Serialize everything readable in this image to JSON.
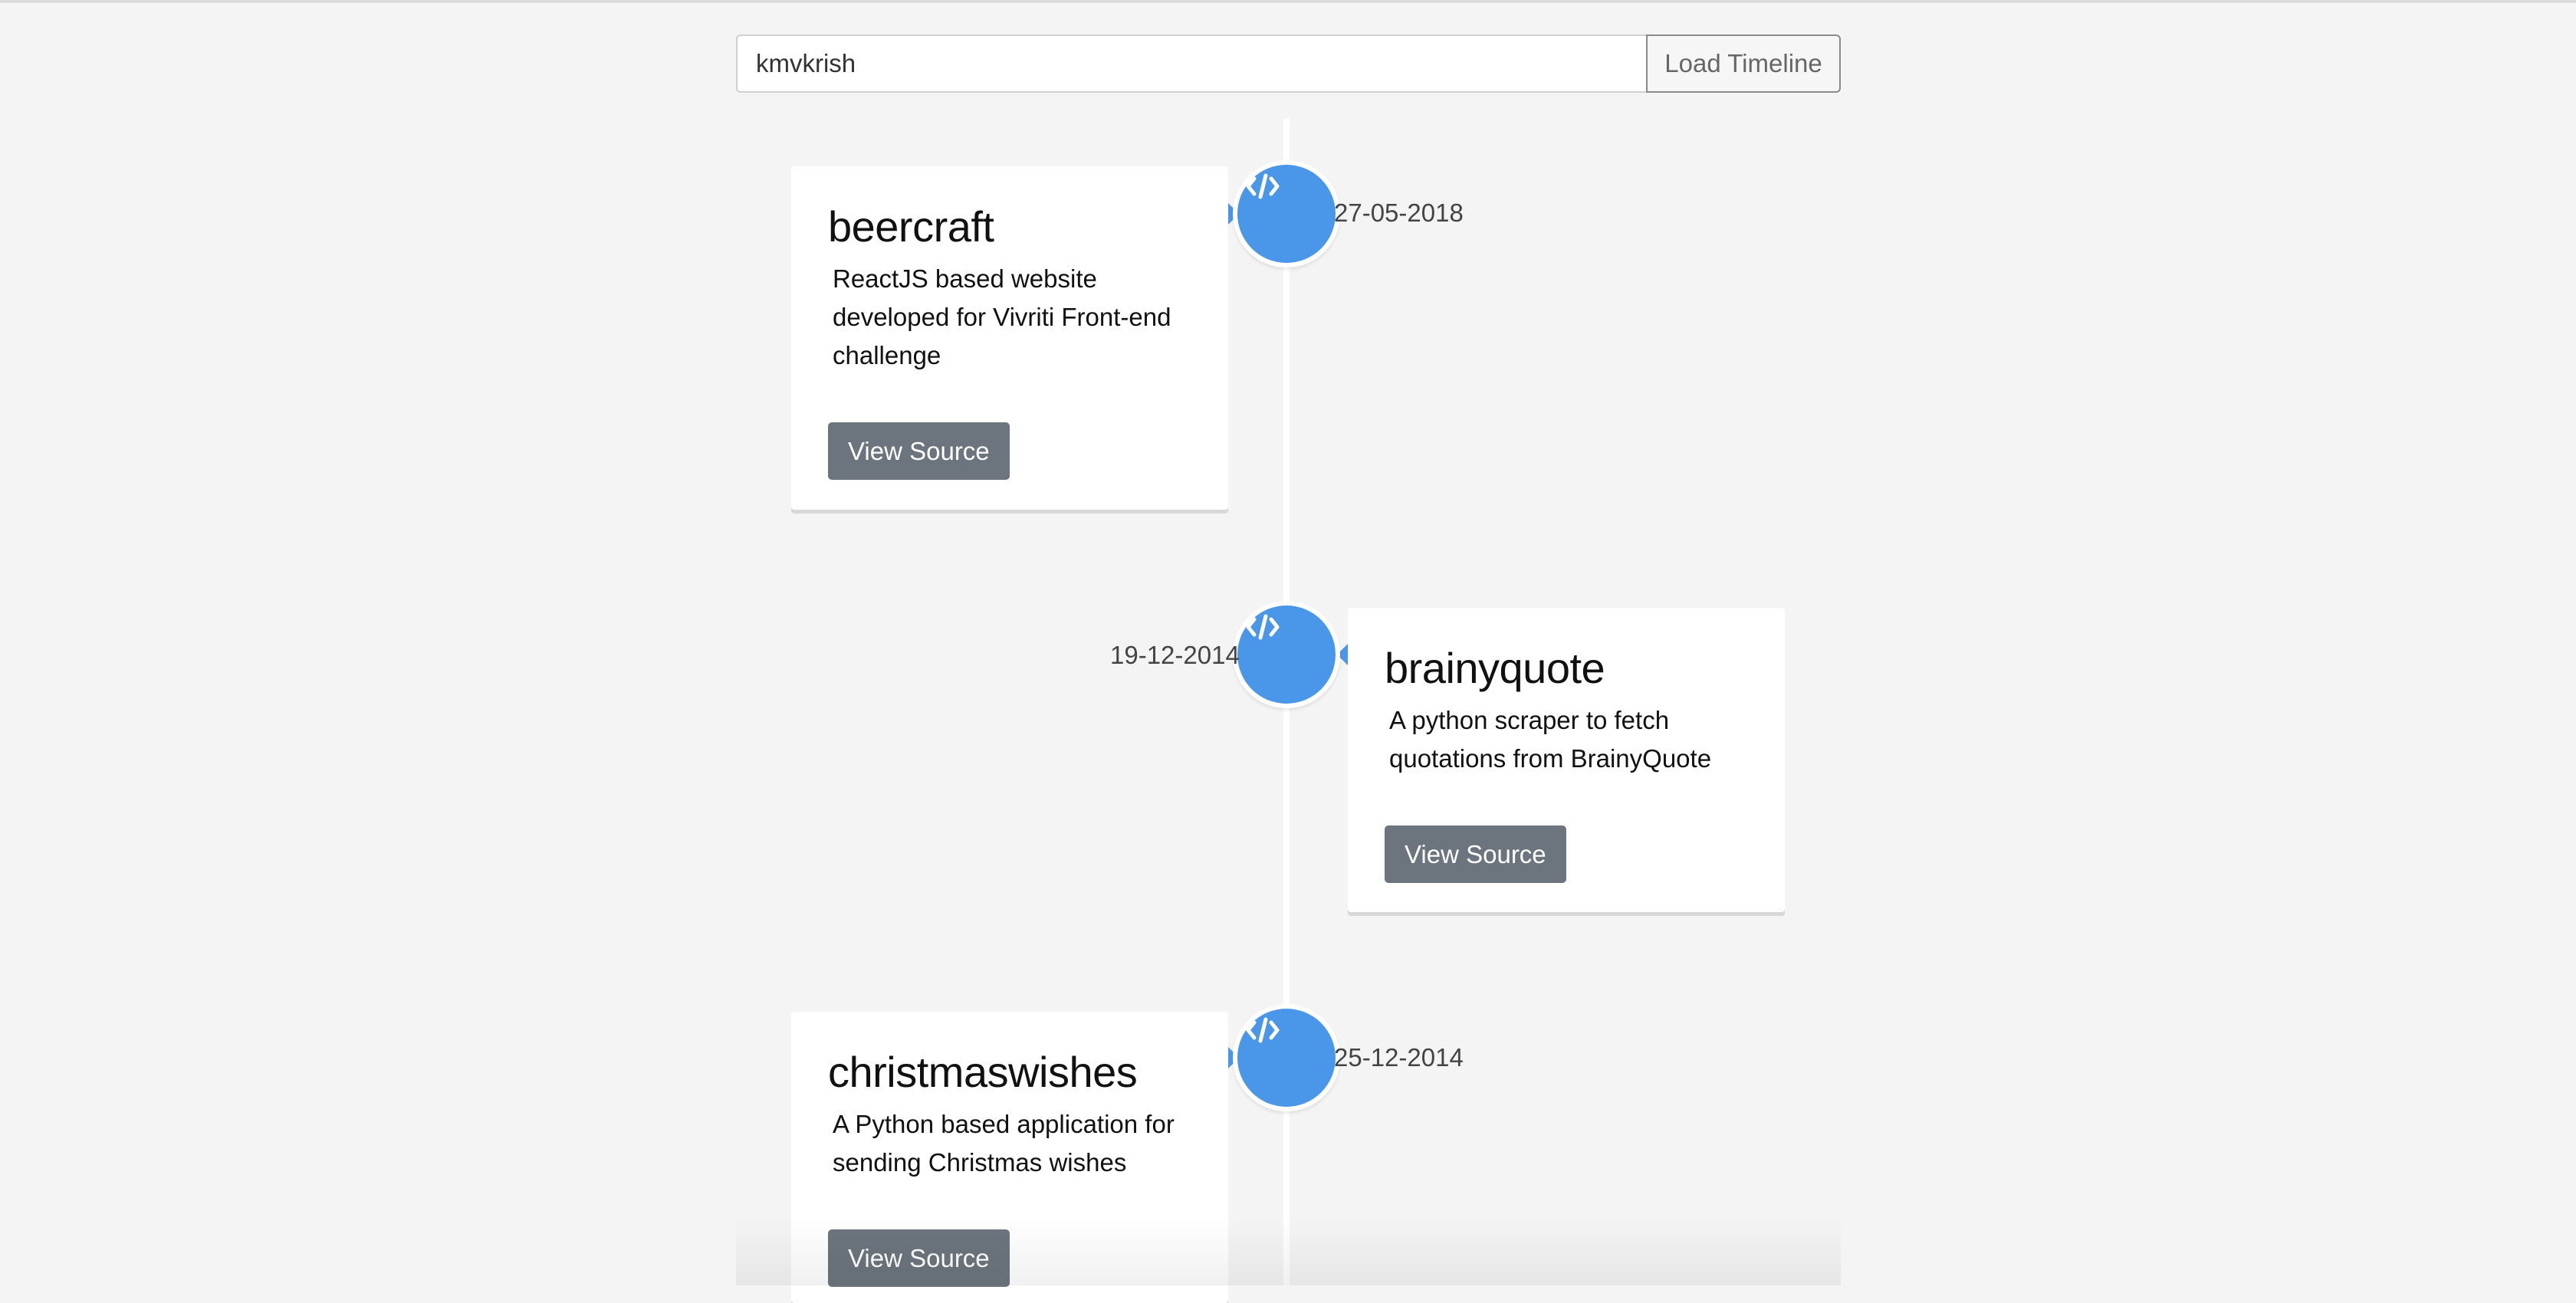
{
  "search": {
    "value": "kmvkrish",
    "button_label": "Load Timeline"
  },
  "timeline": {
    "accent_color": "#4a96e8",
    "items": [
      {
        "title": "beercraft",
        "description": "ReactJS based website developed for Vivriti Front-end challenge",
        "button_label": "View Source",
        "date": "27-05-2018",
        "icon": "code-icon"
      },
      {
        "title": "brainyquote",
        "description": "A python scraper to fetch quotations from BrainyQuote",
        "button_label": "View Source",
        "date": "19-12-2014",
        "icon": "code-icon"
      },
      {
        "title": "christmaswishes",
        "description": "A Python based application for sending Christmas wishes",
        "button_label": "View Source",
        "date": "25-12-2014",
        "icon": "code-icon"
      }
    ]
  }
}
